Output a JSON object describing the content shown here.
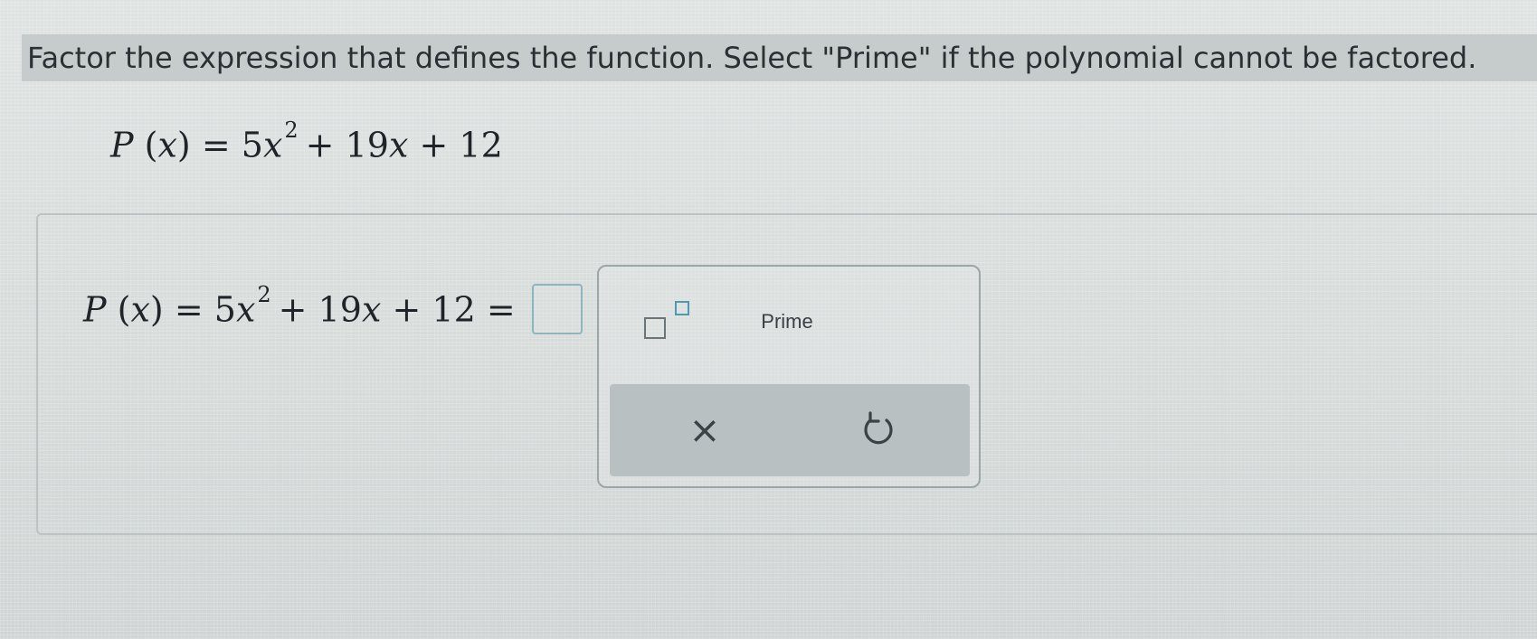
{
  "instruction": {
    "text": "Factor the expression that defines the function. Select \"Prime\" if the polynomial cannot be factored."
  },
  "problem": {
    "fn_name": "P",
    "variable": "x",
    "coef_a": "5",
    "exponent": "2",
    "term_b": "+ 19",
    "term_c": "+ 12",
    "equals": "="
  },
  "palette": {
    "superscript_icon": "superscript-template-icon",
    "prime_label": "Prime",
    "clear_symbol": "×",
    "clear_icon": "close-icon",
    "undo_icon": "undo-icon"
  },
  "colors": {
    "accent": "#4d9ab1",
    "answer_box_border": "#8fb4be",
    "action_bar": "#b9c0c1",
    "instruction_bar": "#c6cccc"
  }
}
